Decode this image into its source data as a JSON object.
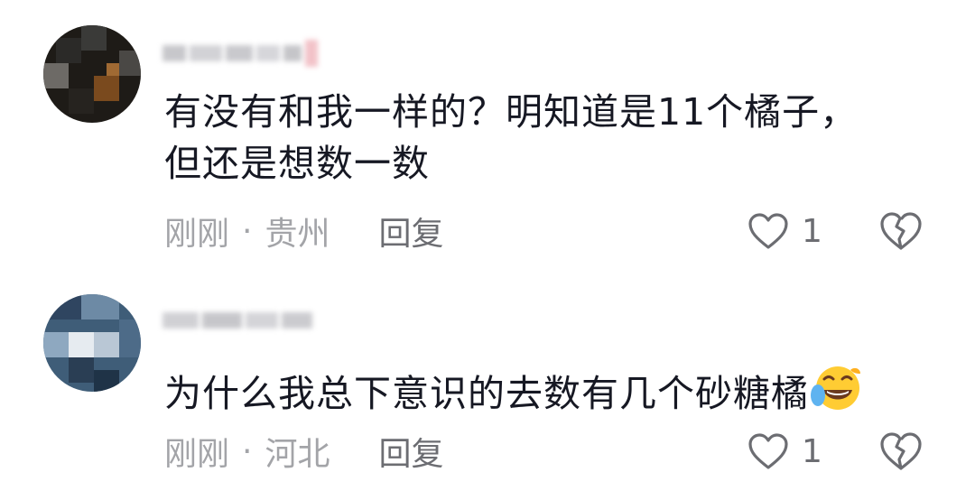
{
  "comments": [
    {
      "content_lines": [
        "有没有和我一样的？明知道是11个橘子，",
        "但还是想数一数"
      ],
      "time": "刚刚",
      "separator": "·",
      "location": "贵州",
      "reply_label": "回复",
      "like_count": "1"
    },
    {
      "content_lines": [
        "为什么我总下意识的去数有几个砂糖橘"
      ],
      "emoji": "laughing-crying-emoji",
      "time": "刚刚",
      "separator": "·",
      "location": "河北",
      "reply_label": "回复",
      "like_count": "1"
    }
  ],
  "icons": {
    "like": "heart-outline-icon",
    "dislike": "broken-heart-icon"
  },
  "colors": {
    "text": "#161823",
    "meta": "#a3a4a8",
    "reply": "#6c6d72"
  }
}
